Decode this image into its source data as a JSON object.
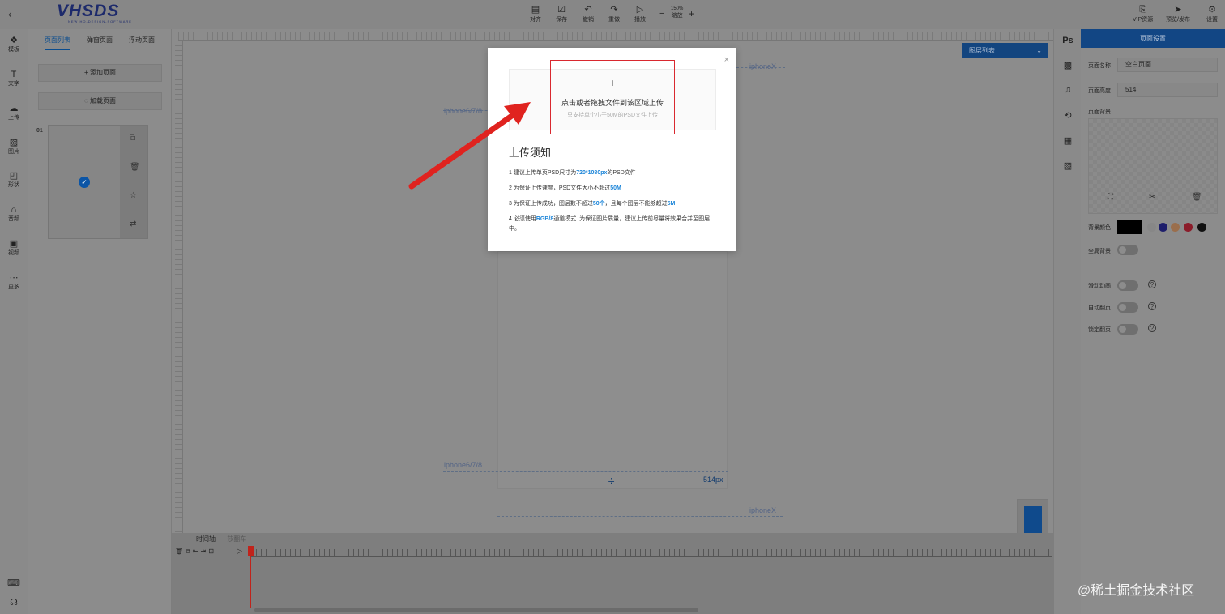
{
  "topbar": {
    "back_icon": "chevron-left-icon",
    "logo_text": "VHSDS",
    "logo_sub": "NEW HO-DESIGN-SOFTWARE",
    "tools": [
      {
        "label": "对齐",
        "icon": "align-icon"
      },
      {
        "label": "保存",
        "icon": "save-icon"
      },
      {
        "label": "撤销",
        "icon": "undo-icon"
      },
      {
        "label": "重做",
        "icon": "redo-icon"
      },
      {
        "label": "播放",
        "icon": "play-icon"
      }
    ],
    "zoom_minus": "−",
    "zoom_value": "150%",
    "zoom_label": "缩放",
    "zoom_plus": "+",
    "right_tools": [
      {
        "label": "VIP资源",
        "icon": "vip-icon"
      },
      {
        "label": "预览/发布",
        "icon": "send-icon"
      },
      {
        "label": "设置",
        "icon": "gear-icon"
      }
    ]
  },
  "sidenav": {
    "items": [
      {
        "label": "模板",
        "icon": "template-icon"
      },
      {
        "label": "文字",
        "icon": "text-icon"
      },
      {
        "label": "上传",
        "icon": "upload-icon"
      },
      {
        "label": "图片",
        "icon": "image-icon"
      },
      {
        "label": "形状",
        "icon": "shape-icon"
      },
      {
        "label": "音频",
        "icon": "headphones-icon"
      },
      {
        "label": "视频",
        "icon": "video-icon"
      },
      {
        "label": "更多",
        "icon": "more-icon"
      }
    ]
  },
  "pages_panel": {
    "tabs": [
      "页面列表",
      "弹窗页面",
      "浮动页面"
    ],
    "add_page": "添加页面",
    "load_page": "加载页面",
    "page_number": "01"
  },
  "canvas": {
    "layer_select": "图层列表",
    "guide_iphonex": "iphoneX",
    "guide_iphone678": "iphone6/7/8",
    "height_label": "514px"
  },
  "timeline": {
    "tab_active": "时间轴",
    "tab_inactive": "莎翻车"
  },
  "right_panel": {
    "title": "页面设置",
    "name_label": "页面名称",
    "name_value": "空白页面",
    "height_label": "页面高度",
    "height_value": "514",
    "bg_label": "页面背景",
    "bg_color_label": "背景颜色",
    "global_bg_label": "全局背景",
    "slide_anim_label": "滑动动画",
    "auto_flip_label": "自动翻页",
    "lock_flip_label": "锁定翻页",
    "swatches": [
      "#878787",
      "#1e1e6b",
      "#9a6e4c",
      "#8b1c2a",
      "#111111"
    ]
  },
  "right_tools": [
    "Ps",
    "texture-icon",
    "music-icon",
    "history-icon",
    "grid-icon",
    "image-icon"
  ],
  "dialog": {
    "close": "×",
    "plus": "+",
    "drop_text": "点击或者拖拽文件到该区域上传",
    "drop_hint": "只支持单个小于50M的PSD文件上传",
    "title": "上传须知",
    "notes": [
      {
        "pre": "1 建议上传单页PSD尺寸为",
        "hl": "720*1080px",
        "post": "的PSD文件"
      },
      {
        "pre": "2 为保证上传速度，PSD文件大小不超过",
        "hl": "50M",
        "post": ""
      },
      {
        "pre": "3 为保证上传成功，图层数不超过",
        "hl": "50个",
        "post": "，且每个图层不能够超过",
        "hl2": "5M"
      },
      {
        "pre": "4 必须使用",
        "hl": "RGB/8",
        "post": "通道模式. 为保证图片质量，建议上传前尽量将效果合并至图层中。"
      }
    ]
  },
  "watermark": "@稀土掘金技术社区"
}
